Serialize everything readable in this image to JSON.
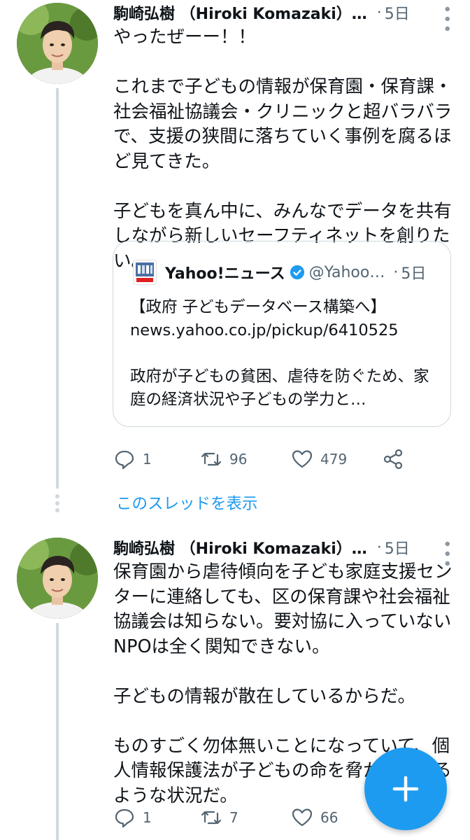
{
  "tweets": [
    {
      "author": "駒崎弘樹 （Hiroki Komazaki）…",
      "separator": "·",
      "time": "5日",
      "text": "やったぜーー！！\n\nこれまで子どもの情報が保育園・保育課・社会福祉協議会・クリニックと超バラバラで、支援の狭間に落ちていく事例を腐るほど見てきた。\n\n子どもを真ん中に、みんなでデータを共有しながら新しいセーフティネットを創りたい。",
      "quoted": {
        "source_name": "Yahoo!ニュース",
        "handle": "@Yahoo…",
        "separator": "·",
        "time": "5日",
        "text": "【政府 子どもデータベース構築へ】\nnews.yahoo.co.jp/pickup/6410525\n\n政府が子どもの貧困、虐待を防ぐため、家庭の経済状況や子どもの学力と…"
      },
      "actions": {
        "replies": "1",
        "retweets": "96",
        "likes": "479"
      }
    },
    {
      "author": "駒崎弘樹 （Hiroki Komazaki）…",
      "separator": "·",
      "time": "5日",
      "text": "保育園から虐待傾向を子ども家庭支援センターに連絡しても、区の保育課や社会福祉協議会は知らない。要対協に入っていないNPOは全く関知できない。\n\n子どもの情報が散在しているからだ。\n\nものすごく勿体無いことになっていて、個人情報保護法が子どもの命を脅かしているような状況だ。",
      "actions": {
        "replies": "1",
        "retweets": "7",
        "likes": "66"
      }
    }
  ],
  "show_thread_label": "このスレッドを表示",
  "colors": {
    "accent": "#1d9bf0",
    "muted": "#536471",
    "border": "#cfd9de"
  },
  "icons": [
    "reply-icon",
    "retweet-icon",
    "like-icon",
    "share-icon",
    "more-icon",
    "verified-icon",
    "compose-plus-icon"
  ]
}
